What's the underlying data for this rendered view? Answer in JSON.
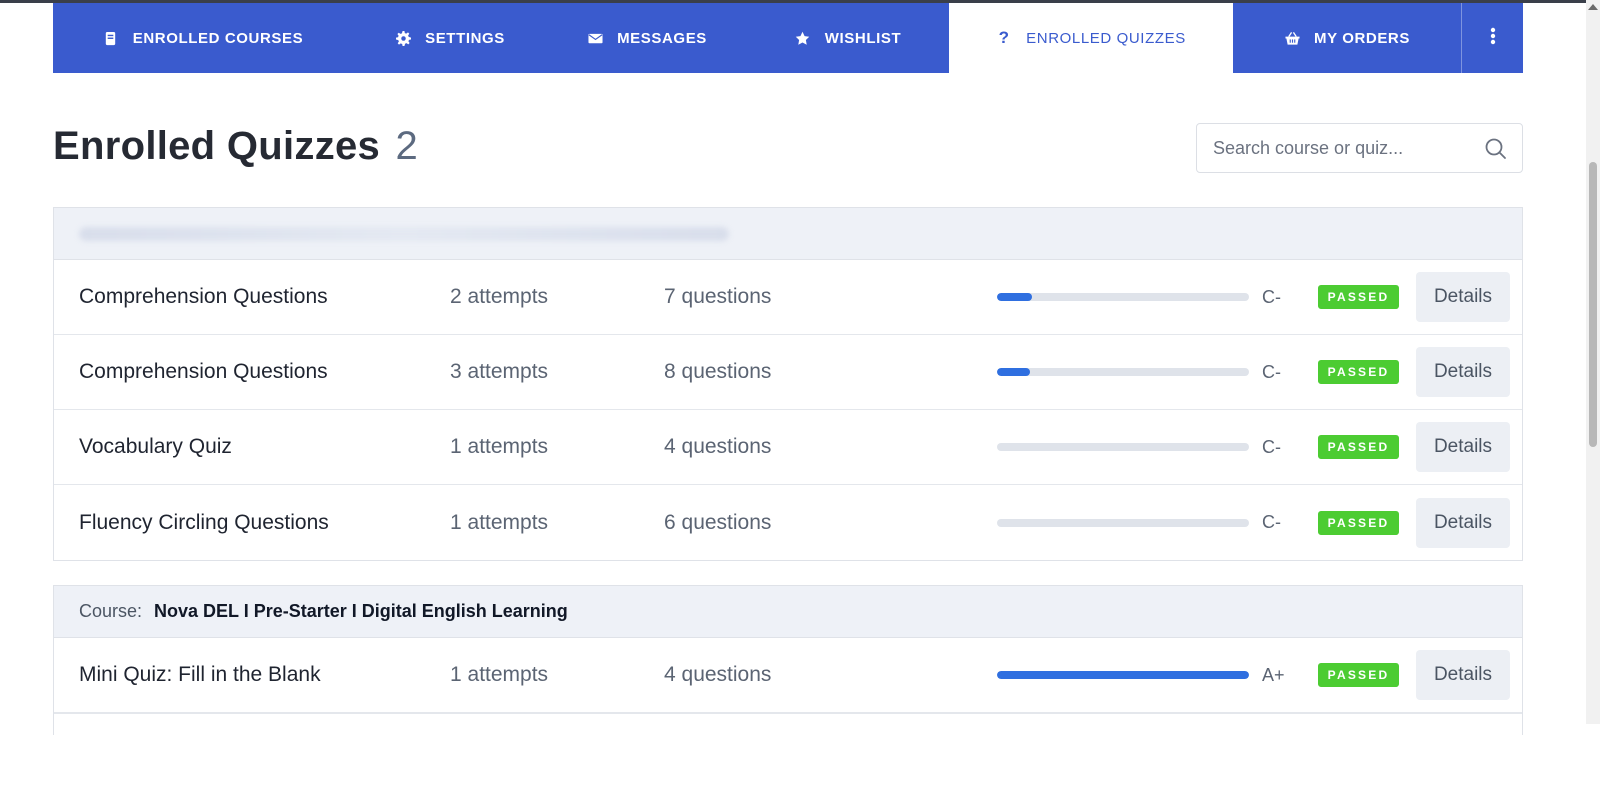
{
  "tabs": [
    {
      "label": "ENROLLED COURSES",
      "icon": "book-icon",
      "active": false
    },
    {
      "label": "SETTINGS",
      "icon": "gear-icon",
      "active": false
    },
    {
      "label": "MESSAGES",
      "icon": "envelope-icon",
      "active": false
    },
    {
      "label": "WISHLIST",
      "icon": "star-icon",
      "active": false
    },
    {
      "label": "ENROLLED QUIZZES",
      "icon": "question-icon",
      "active": true
    },
    {
      "label": "MY ORDERS",
      "icon": "basket-icon",
      "active": false
    }
  ],
  "page": {
    "title": "Enrolled Quizzes",
    "count": "2"
  },
  "search": {
    "placeholder": "Search course or quiz..."
  },
  "colors": {
    "accent": "#3a5bce",
    "progress": "#2f6fe0",
    "passed": "#4ccc32"
  },
  "courses": [
    {
      "label": "",
      "name": "",
      "quizzes": [
        {
          "title": "Comprehension Questions",
          "attempts": "2 attempts",
          "questions": "7 questions",
          "progress": 0.14,
          "grade": "C-",
          "status": "PASSED",
          "details": "Details"
        },
        {
          "title": "Comprehension Questions",
          "attempts": "3 attempts",
          "questions": "8 questions",
          "progress": 0.13,
          "grade": "C-",
          "status": "PASSED",
          "details": "Details"
        },
        {
          "title": "Vocabulary Quiz",
          "attempts": "1 attempts",
          "questions": "4 questions",
          "progress": 0.0,
          "grade": "C-",
          "status": "PASSED",
          "details": "Details"
        },
        {
          "title": "Fluency Circling Questions",
          "attempts": "1 attempts",
          "questions": "6 questions",
          "progress": 0.0,
          "grade": "C-",
          "status": "PASSED",
          "details": "Details"
        }
      ]
    },
    {
      "label": "Course:",
      "name": "Nova DEL I Pre-Starter I Digital English Learning",
      "quizzes": [
        {
          "title": "Mini Quiz: Fill in the Blank",
          "attempts": "1 attempts",
          "questions": "4 questions",
          "progress": 1.0,
          "grade": "A+",
          "status": "PASSED",
          "details": "Details"
        }
      ]
    }
  ]
}
